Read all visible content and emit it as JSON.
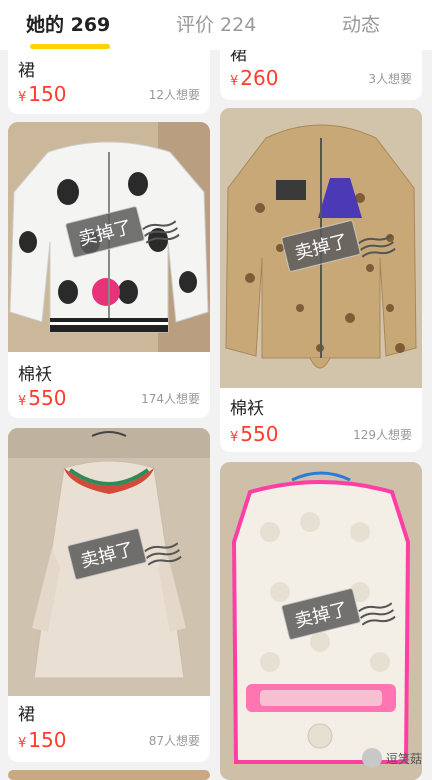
{
  "tabs": [
    {
      "label": "她的 269"
    },
    {
      "label": "评价 224"
    },
    {
      "label": "动态"
    }
  ],
  "currency": "¥",
  "sold_label": "卖掉了",
  "items": [
    {
      "title": "裙",
      "price": "150",
      "wants": "12人想要"
    },
    {
      "title": "裙",
      "price": "260",
      "wants": "3人想要"
    },
    {
      "title": "棉袄",
      "price": "550",
      "wants": "174人想要"
    },
    {
      "title": "棉袄",
      "price": "550",
      "wants": "129人想要"
    },
    {
      "title": "裙",
      "price": "150",
      "wants": "87人想要"
    }
  ],
  "watermark": {
    "text": "逗笑菇"
  },
  "colors": {
    "accent": "#ffd200",
    "price": "#ff3d2e",
    "background": "#f2f2f2"
  }
}
